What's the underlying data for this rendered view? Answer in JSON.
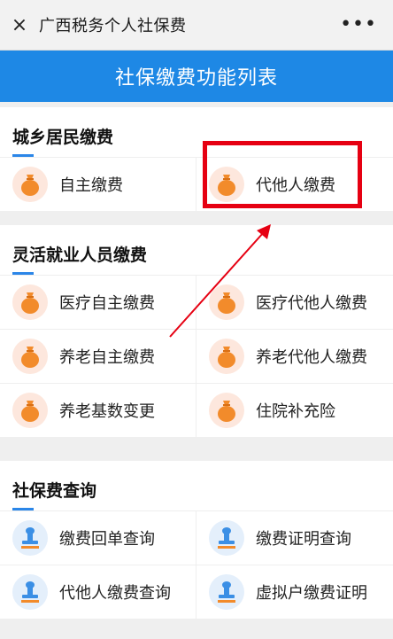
{
  "topbar": {
    "close_icon": "×",
    "title": "广西税务个人社保费",
    "more_icon": "•••"
  },
  "banner": {
    "title": "社保缴费功能列表"
  },
  "sections": [
    {
      "title": "城乡居民缴费",
      "items": [
        {
          "label": "自主缴费"
        },
        {
          "label": "代他人缴费"
        }
      ]
    },
    {
      "title": "灵活就业人员缴费",
      "items": [
        {
          "label": "医疗自主缴费"
        },
        {
          "label": "医疗代他人缴费"
        },
        {
          "label": "养老自主缴费"
        },
        {
          "label": "养老代他人缴费"
        },
        {
          "label": "养老基数变更"
        },
        {
          "label": "住院补充险"
        }
      ]
    },
    {
      "title": "社保费查询",
      "items": [
        {
          "label": "缴费回单查询"
        },
        {
          "label": "缴费证明查询"
        },
        {
          "label": "代他人缴费查询"
        },
        {
          "label": "虚拟户缴费证明"
        }
      ]
    }
  ],
  "colors": {
    "banner": "#1e88e5",
    "highlight": "#e60012",
    "icon_orange": "#f28b2b",
    "icon_blue": "#3b8fe5"
  }
}
